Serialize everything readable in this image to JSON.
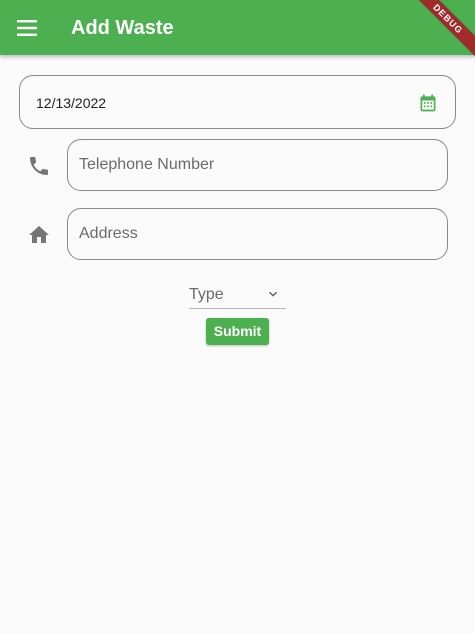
{
  "appbar": {
    "title": "Add Waste",
    "menu_icon": "menu-icon",
    "background": "#4caf50",
    "debug_label": "DEBUG"
  },
  "form": {
    "date_value": "12/13/2022",
    "calendar_icon": "calendar-icon",
    "telephone": {
      "icon": "phone-icon",
      "placeholder": "Telephone Number",
      "value": ""
    },
    "address": {
      "icon": "home-icon",
      "placeholder": "Address",
      "value": ""
    },
    "type_select": {
      "label": "Type",
      "icon": "chevron-down-icon"
    },
    "submit_label": "Submit"
  },
  "colors": {
    "accent": "#4caf50",
    "background": "#fafafa",
    "icon_gray": "#757575",
    "border": "#8a8a8a",
    "debug_ribbon": "#a12a2a"
  }
}
